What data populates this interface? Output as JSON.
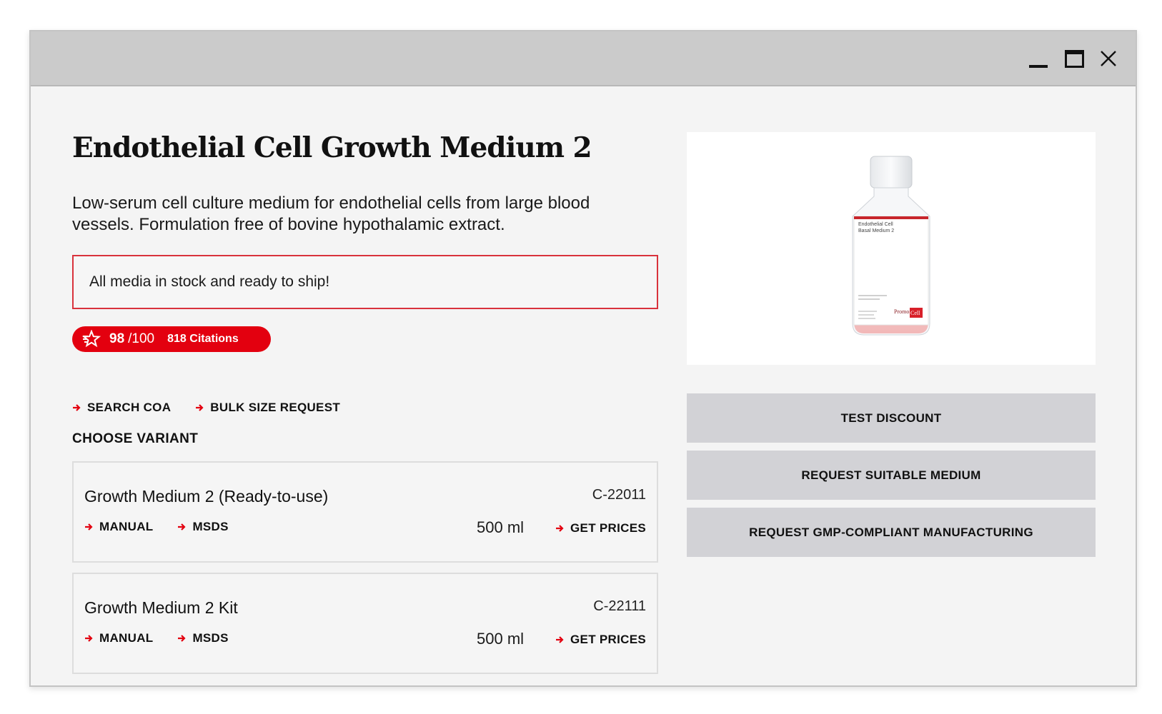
{
  "product": {
    "title": "Endothelial Cell Growth Medium 2",
    "description": "Low-serum cell culture medium for endothelial cells from large blood vessels. Formulation free of bovine hypothalamic extract.",
    "stock_notice": "All media in stock and ready to ship!",
    "score": {
      "value": "98",
      "max": "/100",
      "citations": "818 Citations"
    },
    "links": {
      "search_coa": "SEARCH COA",
      "bulk_size": "BULK SIZE REQUEST"
    },
    "choose_variant": "CHOOSE VARIANT",
    "image": {
      "label_line1": "Endothelial Cell",
      "label_line2": "Basal Medium 2",
      "brand_a": "Promo",
      "brand_b": "Cell"
    }
  },
  "variants": [
    {
      "name": "Growth Medium 2 (Ready-to-use)",
      "sku": "C-22011",
      "size": "500 ml",
      "manual": "MANUAL",
      "msds": "MSDS",
      "price": "GET PRICES"
    },
    {
      "name": "Growth Medium 2 Kit",
      "sku": "C-22111",
      "size": "500 ml",
      "manual": "MANUAL",
      "msds": "MSDS",
      "price": "GET PRICES"
    }
  ],
  "actions": {
    "test_discount": "TEST DISCOUNT",
    "request_medium": "REQUEST SUITABLE MEDIUM",
    "request_gmp": "REQUEST GMP-COMPLIANT MANUFACTURING"
  },
  "window_controls": {
    "close": "X"
  },
  "colors": {
    "accent": "#e3000f",
    "button_bg": "#d2d2d6",
    "titlebar": "#cbcbcb"
  },
  "icons": [
    "minimize-icon",
    "maximize-icon",
    "close-icon",
    "score-star-icon",
    "arrow-right-icon"
  ]
}
